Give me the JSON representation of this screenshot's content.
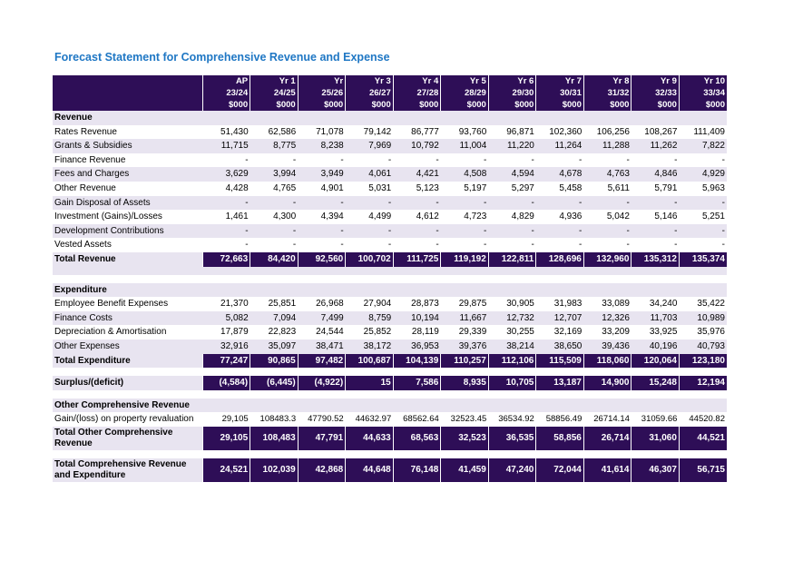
{
  "title": "Forecast Statement for Comprehensive Revenue and Expense",
  "colors": {
    "header_bg": "#2e0e57",
    "band_bg": "#e8e4f0",
    "title": "#1f77c4"
  },
  "header": {
    "row1": [
      "AP",
      "Yr 1",
      "Yr",
      "Yr 3",
      "Yr 4",
      "Yr 5",
      "Yr 6",
      "Yr 7",
      "Yr 8",
      "Yr 9",
      "Yr 10"
    ],
    "row2": [
      "23/24",
      "24/25",
      "25/26",
      "26/27",
      "27/28",
      "28/29",
      "29/30",
      "30/31",
      "31/32",
      "32/33",
      "33/34"
    ],
    "row3": [
      "$000",
      "$000",
      "$000",
      "$000",
      "$000",
      "$000",
      "$000",
      "$000",
      "$000",
      "$000",
      "$000"
    ]
  },
  "sections": {
    "revenue": "Revenue",
    "expenditure": "Expenditure",
    "other": "Other Comprehensive Revenue"
  },
  "rows": {
    "rates": {
      "label": "Rates Revenue",
      "values": [
        "51,430",
        "62,586",
        "71,078",
        "79,142",
        "86,777",
        "93,760",
        "96,871",
        "102,360",
        "106,256",
        "108,267",
        "111,409"
      ]
    },
    "grants": {
      "label": "Grants & Subsidies",
      "values": [
        "11,715",
        "8,775",
        "8,238",
        "7,969",
        "10,792",
        "11,004",
        "11,220",
        "11,264",
        "11,288",
        "11,262",
        "7,822"
      ]
    },
    "finance_rev": {
      "label": "Finance Revenue",
      "values": [
        "-",
        "-",
        "-",
        "-",
        "-",
        "-",
        "-",
        "-",
        "-",
        "-",
        "-"
      ]
    },
    "fees": {
      "label": "Fees and Charges",
      "values": [
        "3,629",
        "3,994",
        "3,949",
        "4,061",
        "4,421",
        "4,508",
        "4,594",
        "4,678",
        "4,763",
        "4,846",
        "4,929"
      ]
    },
    "other_rev": {
      "label": "Other Revenue",
      "values": [
        "4,428",
        "4,765",
        "4,901",
        "5,031",
        "5,123",
        "5,197",
        "5,297",
        "5,458",
        "5,611",
        "5,791",
        "5,963"
      ]
    },
    "gain_disposal": {
      "label": "Gain Disposal of Assets",
      "values": [
        "-",
        "-",
        "-",
        "-",
        "-",
        "-",
        "-",
        "-",
        "-",
        "-",
        "-"
      ]
    },
    "investment": {
      "label": "Investment (Gains)/Losses",
      "values": [
        "1,461",
        "4,300",
        "4,394",
        "4,499",
        "4,612",
        "4,723",
        "4,829",
        "4,936",
        "5,042",
        "5,146",
        "5,251"
      ]
    },
    "dev_contrib": {
      "label": "Development Contributions",
      "values": [
        "-",
        "-",
        "-",
        "-",
        "-",
        "-",
        "-",
        "-",
        "-",
        "-",
        "-"
      ]
    },
    "vested": {
      "label": "Vested Assets",
      "values": [
        "-",
        "-",
        "-",
        "-",
        "-",
        "-",
        "-",
        "-",
        "-",
        "-",
        "-"
      ]
    },
    "total_revenue": {
      "label": "Total Revenue",
      "values": [
        "72,663",
        "84,420",
        "92,560",
        "100,702",
        "111,725",
        "119,192",
        "122,811",
        "128,696",
        "132,960",
        "135,312",
        "135,374"
      ]
    },
    "employee": {
      "label": "Employee Benefit Expenses",
      "values": [
        "21,370",
        "25,851",
        "26,968",
        "27,904",
        "28,873",
        "29,875",
        "30,905",
        "31,983",
        "33,089",
        "34,240",
        "35,422"
      ]
    },
    "finance_costs": {
      "label": "Finance Costs",
      "values": [
        "5,082",
        "7,094",
        "7,499",
        "8,759",
        "10,194",
        "11,667",
        "12,732",
        "12,707",
        "12,326",
        "11,703",
        "10,989"
      ]
    },
    "depreciation": {
      "label": "Depreciation & Amortisation",
      "values": [
        "17,879",
        "22,823",
        "24,544",
        "25,852",
        "28,119",
        "29,339",
        "30,255",
        "32,169",
        "33,209",
        "33,925",
        "35,976"
      ]
    },
    "other_exp": {
      "label": "Other Expenses",
      "values": [
        "32,916",
        "35,097",
        "38,471",
        "38,172",
        "36,953",
        "39,376",
        "38,214",
        "38,650",
        "39,436",
        "40,196",
        "40,793"
      ]
    },
    "total_expenditure": {
      "label": "Total Expenditure",
      "values": [
        "77,247",
        "90,865",
        "97,482",
        "100,687",
        "104,139",
        "110,257",
        "112,106",
        "115,509",
        "118,060",
        "120,064",
        "123,180"
      ]
    },
    "surplus": {
      "label": "Surplus/(deficit)",
      "values": [
        "(4,584)",
        "(6,445)",
        "(4,922)",
        "15",
        "7,586",
        "8,935",
        "10,705",
        "13,187",
        "14,900",
        "15,248",
        "12,194"
      ]
    },
    "gain_reval": {
      "label": "Gain/(loss) on property revaluation",
      "values": [
        "29,105",
        "108483.3",
        "47790.52",
        "44632.97",
        "68562.64",
        "32523.45",
        "36534.92",
        "58856.49",
        "26714.14",
        "31059.66",
        "44520.82"
      ]
    },
    "total_other": {
      "label": "Total Other Comprehensive Revenue",
      "values": [
        "29,105",
        "108,483",
        "47,791",
        "44,633",
        "68,563",
        "32,523",
        "36,535",
        "58,856",
        "26,714",
        "31,060",
        "44,521"
      ]
    },
    "total_comp": {
      "label": "Total Comprehensive Revenue and Expenditure",
      "values": [
        "24,521",
        "102,039",
        "42,868",
        "44,648",
        "76,148",
        "41,459",
        "47,240",
        "72,044",
        "41,614",
        "46,307",
        "56,715"
      ]
    }
  }
}
